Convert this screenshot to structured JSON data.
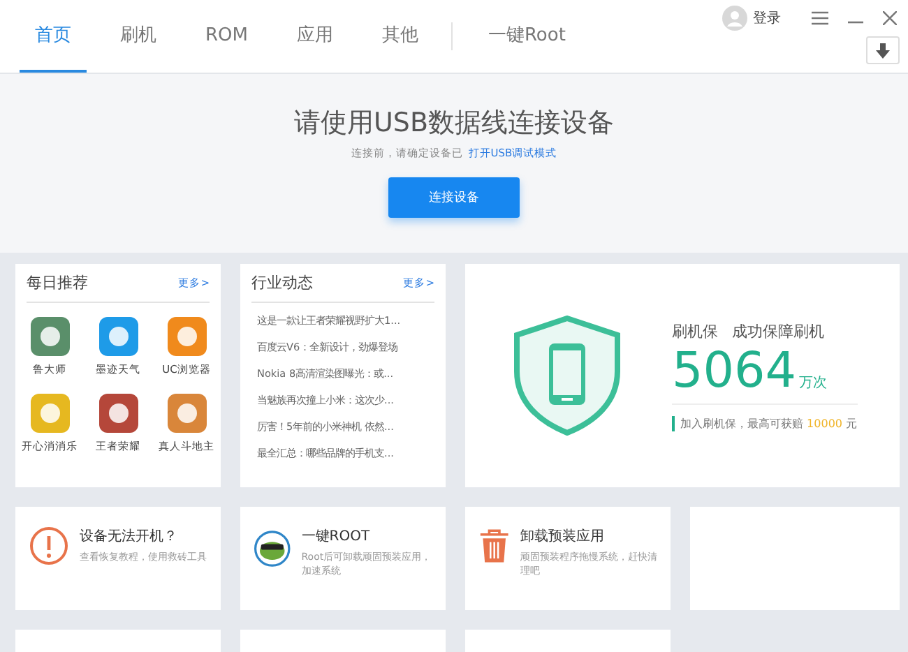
{
  "tabs": [
    {
      "label": "首页",
      "selected": true
    },
    {
      "label": "刷机",
      "selected": false
    },
    {
      "label": "ROM",
      "selected": false
    },
    {
      "label": "应用",
      "selected": false
    },
    {
      "label": "其他",
      "selected": false
    },
    {
      "label": "一键Root",
      "selected": false
    }
  ],
  "account": {
    "login": "登录"
  },
  "hero": {
    "title": "请使用USB数据线连接设备",
    "hint": "连接前，请确定设备已",
    "link": "打开USB调试模式",
    "button": "连接设备"
  },
  "daily": {
    "title": "每日推荐",
    "more": "更多>",
    "apps": [
      {
        "name": "鲁大师"
      },
      {
        "name": "墨迹天气"
      },
      {
        "name": "UC浏览器"
      },
      {
        "name": "开心消消乐"
      },
      {
        "name": "王者荣耀"
      },
      {
        "name": "真人斗地主"
      }
    ]
  },
  "news": {
    "title": "行业动态",
    "more": "更多>",
    "items": [
      "这是一款让王者荣耀视野扩大1...",
      "百度云V6：全新设计，劲爆登场",
      "Nokia 8高清渲染图曝光：或...",
      "当魅族再次撞上小米：这次少...",
      "厉害！5年前的小米神机 依然...",
      "最全汇总：哪些品牌的手机支..."
    ]
  },
  "guarantee": {
    "name": "刷机保",
    "slogan": "成功保障刷机",
    "count": "5064",
    "unit": "万次",
    "note": "加入刷机保，最高可获赔",
    "amount": "10000",
    "currency": "元"
  },
  "tools": [
    {
      "kind": "alert",
      "title": "设备无法开机？",
      "desc": "查看恢复教程，使用救砖工具"
    },
    {
      "kind": "root",
      "title": "一键ROOT",
      "desc": "Root后可卸载顽固预装应用，加速系统"
    },
    {
      "kind": "trash",
      "title": "卸载预装应用",
      "desc": "顽固预装程序拖慢系统，赶快清理吧"
    }
  ]
}
